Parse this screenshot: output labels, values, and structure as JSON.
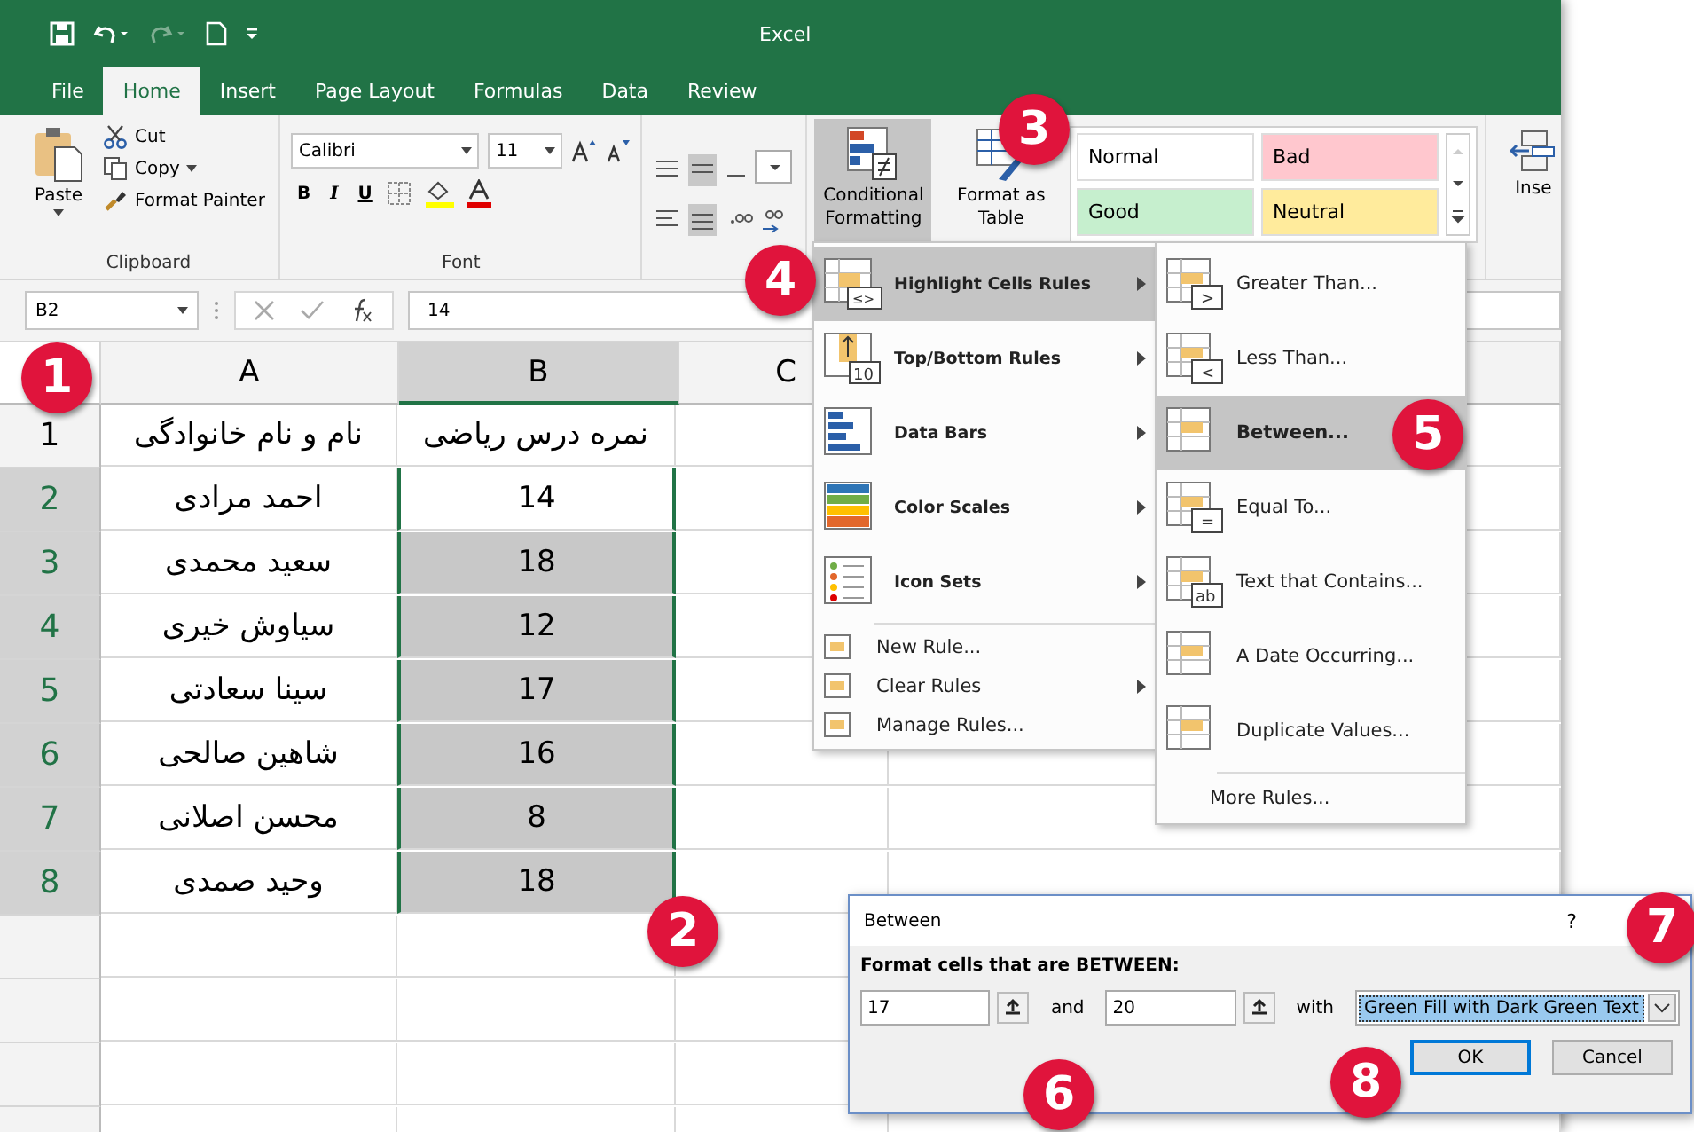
{
  "title_bar": {
    "title": "Excel"
  },
  "ribbon_tabs": [
    {
      "label": "File",
      "selected": false
    },
    {
      "label": "Home",
      "selected": true
    },
    {
      "label": "Insert",
      "selected": false
    },
    {
      "label": "Page Layout",
      "selected": false
    },
    {
      "label": "Formulas",
      "selected": false
    },
    {
      "label": "Data",
      "selected": false
    },
    {
      "label": "Review",
      "selected": false
    }
  ],
  "clipboard_group": {
    "paste": "Paste",
    "cut": "Cut",
    "copy": "Copy",
    "format_painter": "Format Painter",
    "label": "Clipboard"
  },
  "font_group": {
    "font_name": "Calibri",
    "font_size": "11",
    "bold": "B",
    "italic": "I",
    "underline": "U",
    "label": "Font"
  },
  "styles_group": {
    "conditional_formatting": {
      "label": "Conditional Formatting",
      "selected": true
    },
    "format_as_table": "Format as Table",
    "cell_styles": [
      {
        "label": "Normal",
        "color": "#ffffff"
      },
      {
        "label": "Bad",
        "color": "#ffc7ce"
      },
      {
        "label": "Good",
        "color": "#c6efce"
      },
      {
        "label": "Neutral",
        "color": "#ffeb9c"
      }
    ]
  },
  "cells_group": {
    "insert": "Inse"
  },
  "formula_bar": {
    "name_box": "B2",
    "value": "14"
  },
  "sheet": {
    "columns": [
      {
        "label": "A",
        "selected": false
      },
      {
        "label": "B",
        "selected": true
      },
      {
        "label": "C",
        "selected": false
      }
    ],
    "rows": [
      {
        "number": "1",
        "cells": [
          "نام و نام خانوادگی",
          "نمره درس ریاضی"
        ],
        "selected": false,
        "active": false
      },
      {
        "number": "2",
        "cells": [
          "احمد مرادی",
          "14"
        ],
        "selected": true,
        "active": true
      },
      {
        "number": "3",
        "cells": [
          "سعید محمدی",
          "18"
        ],
        "selected": true,
        "active": false
      },
      {
        "number": "4",
        "cells": [
          "سیاوش خیری",
          "12"
        ],
        "selected": true,
        "active": false
      },
      {
        "number": "5",
        "cells": [
          "سینا سعادتی",
          "17"
        ],
        "selected": true,
        "active": false
      },
      {
        "number": "6",
        "cells": [
          "شاهین صالحی",
          "16"
        ],
        "selected": true,
        "active": false
      },
      {
        "number": "7",
        "cells": [
          "محسن اصلانی",
          "8"
        ],
        "selected": true,
        "active": false
      },
      {
        "number": "8",
        "cells": [
          "وحید صمدی",
          "18"
        ],
        "selected": true,
        "active": false
      }
    ]
  },
  "conditional_formatting_menu": {
    "items": [
      {
        "label": "Highlight Cells Rules",
        "kind": "highlight",
        "icon_text": "≤>",
        "submenu": true,
        "selected": true
      },
      {
        "label": "Top/Bottom Rules",
        "kind": "topbottom",
        "icon_text": "10",
        "submenu": true,
        "selected": false
      },
      {
        "label": "Data Bars",
        "kind": "databars",
        "submenu": true,
        "selected": false
      },
      {
        "label": "Color Scales",
        "kind": "colorscales",
        "submenu": true,
        "selected": false
      },
      {
        "label": "Icon Sets",
        "kind": "iconsets",
        "submenu": true,
        "selected": false
      },
      {
        "label": "New Rule...",
        "kind": "small",
        "submenu": false,
        "selected": false
      },
      {
        "label": "Clear Rules",
        "kind": "small",
        "submenu": true,
        "selected": false
      },
      {
        "label": "Manage Rules...",
        "kind": "small",
        "submenu": false,
        "selected": false
      }
    ]
  },
  "highlight_submenu": {
    "items": [
      {
        "label": "Greater Than...",
        "symbol": ">",
        "selected": false
      },
      {
        "label": "Less Than...",
        "symbol": "<",
        "selected": false
      },
      {
        "label": "Between...",
        "selected": true
      },
      {
        "label": "Equal To...",
        "symbol": "=",
        "selected": false
      },
      {
        "label": "Text that Contains...",
        "symbol": "ab",
        "selected": false
      },
      {
        "label": "A Date Occurring...",
        "selected": false
      },
      {
        "label": "Duplicate Values...",
        "selected": false
      }
    ],
    "more_rules": "More Rules..."
  },
  "dialog": {
    "title": "Between",
    "help": "?",
    "prompt": "Format cells that are BETWEEN:",
    "from": "17",
    "and_label": "and",
    "to": "20",
    "with_label": "with",
    "format": "Green Fill with Dark Green Text",
    "ok": "OK",
    "cancel": "Cancel"
  },
  "callouts": [
    "1",
    "2",
    "3",
    "4",
    "5",
    "6",
    "7",
    "8"
  ]
}
